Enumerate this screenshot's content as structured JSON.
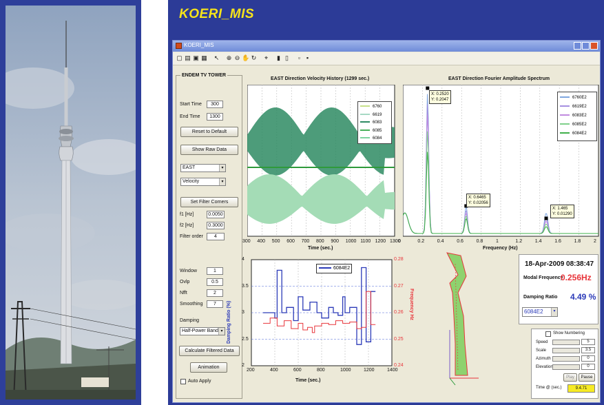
{
  "app": {
    "title": "KOERI_MIS",
    "window_title": "KOERI_MIS"
  },
  "panel": {
    "group_title": "ENDEM TV TOWER",
    "start_time_label": "Start Time",
    "start_time_value": "300",
    "end_time_label": "End Time",
    "end_time_value": "1300",
    "reset_button": "Reset to Default",
    "show_raw_button": "Show Raw Data",
    "direction_select": "EAST",
    "type_select": "Velocity",
    "filter_corners_button": "Set Filter Corners",
    "f1_label": "f1 [Hz]",
    "f1_value": "0.0050",
    "f2_label": "f2 [Hz]",
    "f2_value": "0.3000",
    "filter_order_label": "Filter order",
    "filter_order_value": "4",
    "window_label": "Window",
    "window_value": "1",
    "overlap_label": "Ovlp",
    "overlap_value": "0.5",
    "nfft_label": "Nfft",
    "nfft_value": "2",
    "smoothing_label": "Smoothing",
    "smoothing_value": "7",
    "damping_label": "Damping",
    "damping_method_select": "Half-Power Band...",
    "calc_button": "Calculate Filtered Data",
    "animation_button": "Animation",
    "auto_apply_label": "Auto Apply"
  },
  "velocity_plot": {
    "title": "EAST Direction Velocity History (1299 sec.)",
    "xlabel": "Time (sec.)",
    "xticks": [
      "300",
      "400",
      "500",
      "600",
      "700",
      "800",
      "900",
      "1000",
      "1100",
      "1200",
      "1300"
    ],
    "legend": [
      "6760",
      "6619",
      "6083",
      "6085",
      "6084"
    ]
  },
  "spectrum_plot": {
    "title": "EAST Direction Fourier Amplitude Spectrum",
    "xlabel": "Frequency (Hz)",
    "xticks": [
      "0",
      "0.2",
      "0.4",
      "0.6",
      "0.8",
      "1",
      "1.2",
      "1.4",
      "1.6",
      "1.8",
      "2"
    ],
    "legend": [
      "6760E2",
      "6619E2",
      "6083E2",
      "6085E2",
      "6084E2"
    ],
    "peak1": {
      "x": "X: 0.2520",
      "y": "Y: 0.2047"
    },
    "peak2": {
      "x": "X: 0.6465",
      "y": "Y: 0.02056"
    },
    "peak3": {
      "x": "X: 1.465",
      "y": "Y: 0.01290"
    }
  },
  "damping_plot": {
    "ylabel_left": "Damping Ratio (%)",
    "ylabel_right": "Frequency Hz",
    "xlabel": "Time (sec.)",
    "xticks": [
      "200",
      "400",
      "600",
      "800",
      "1000",
      "1200",
      "1400"
    ],
    "yticks_left": [
      "4",
      "3.5",
      "3",
      "2.5",
      "2"
    ],
    "yticks_right": [
      "0.28",
      "0.27",
      "0.26",
      "0.25",
      "0.24"
    ],
    "legend": "6084E2"
  },
  "summary": {
    "datetime": "18-Apr-2009 08:38:47",
    "modal_label": "Modal Frequency",
    "modal_value": "0.256Hz",
    "damping_label": "Damping Ratio",
    "damping_value": "4.49 %",
    "station_select": "6084E2"
  },
  "controls": {
    "show_numbering": "Show Numbering",
    "speed_label": "Speed",
    "speed_value": "5",
    "scale_label": "Scale",
    "scale_value": "3.5",
    "azimuth_label": "Azimuth",
    "azimuth_value": "0",
    "elevation_label": "Elevation",
    "elevation_value": "0",
    "play_button": "Play",
    "pause_button": "Pause",
    "time_label": "Time @ (sec.)",
    "time_value": "9.4.71"
  },
  "colors": {
    "slide": "#2c3b97",
    "title": "#f7e41a",
    "blue_series": "#2b3ab8",
    "red_series": "#e8343a",
    "green_dark": "#2e8b63",
    "green_light": "#a4dcb6"
  }
}
